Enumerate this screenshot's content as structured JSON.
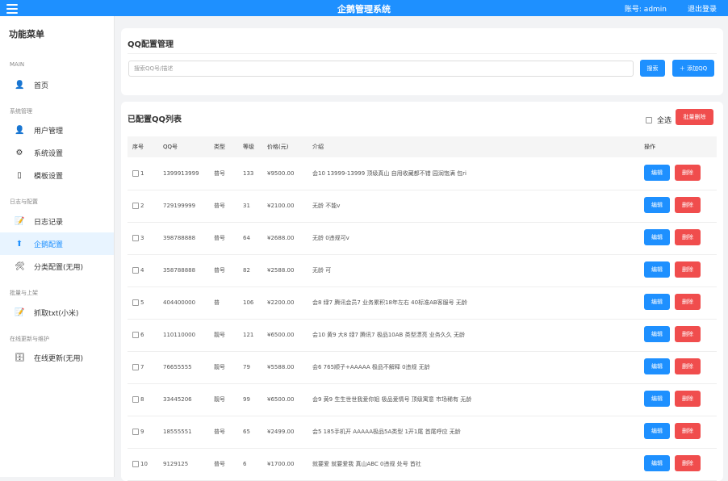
{
  "header": {
    "title": "企鹅管理系统",
    "account": "账号: admin",
    "logout": "退出登录"
  },
  "sidebar": {
    "title": "功能菜单",
    "sections": [
      {
        "label": "MAIN",
        "items": [
          {
            "label": "首页",
            "icon": "user-icon"
          }
        ]
      },
      {
        "label": "系统管理",
        "items": [
          {
            "label": "用户管理",
            "icon": "user-icon"
          },
          {
            "label": "系统设置",
            "icon": "gear-icon"
          },
          {
            "label": "模板设置",
            "icon": "template-icon"
          }
        ]
      },
      {
        "label": "日志与配置",
        "items": [
          {
            "label": "日志记录",
            "icon": "notepad-icon"
          },
          {
            "label": "企鹅配置",
            "icon": "arrow-up-icon"
          },
          {
            "label": "分类配置(无用)",
            "icon": "tools-icon"
          }
        ]
      },
      {
        "label": "批量与上架",
        "items": [
          {
            "label": "抓取txt(小米)",
            "icon": "notepad-icon"
          }
        ]
      },
      {
        "label": "在线更新与维护",
        "items": [
          {
            "label": "在线更新(无用)",
            "icon": "file-icon"
          }
        ]
      }
    ],
    "active": "企鹅配置"
  },
  "search_card": {
    "title": "QQ配置管理",
    "search_placeholder": "搜索QQ号/描述",
    "search_button": "搜索",
    "add_button": "＋ 添加QQ"
  },
  "list_card": {
    "title": "已配置QQ列表",
    "select_all": "全选",
    "batch_delete": "批量删除",
    "columns": [
      "序号",
      "QQ号",
      "类型",
      "等级",
      "价格(元)",
      "介绍",
      "操作"
    ],
    "edit_label": "编辑",
    "delete_label": "删除",
    "rows": [
      {
        "no": "1",
        "qq": "1399913999",
        "type": "普号",
        "level": "133",
        "price": "¥9500.00",
        "desc": "会10 13999-13999 顶级真山 自用收藏都不错 园润饱满 包ri"
      },
      {
        "no": "2",
        "qq": "729199999",
        "type": "普号",
        "level": "31",
        "price": "¥2100.00",
        "desc": "无龄 不能v"
      },
      {
        "no": "3",
        "qq": "398788888",
        "type": "普号",
        "level": "64",
        "price": "¥2688.00",
        "desc": "无龄 0违规可v"
      },
      {
        "no": "4",
        "qq": "358788888",
        "type": "普号",
        "level": "82",
        "price": "¥2588.00",
        "desc": "无龄 可"
      },
      {
        "no": "5",
        "qq": "404400000",
        "type": "普",
        "level": "106",
        "price": "¥2200.00",
        "desc": "会8 绿7 腾讯会员7 业务累积18年左右 40标准AB客服号 无龄"
      },
      {
        "no": "6",
        "qq": "110110000",
        "type": "靓号",
        "level": "121",
        "price": "¥6500.00",
        "desc": "会10 黄9 大8 绿7 腾讯7 极品10AB 类型漂亮 业务久久 无龄"
      },
      {
        "no": "7",
        "qq": "76655555",
        "type": "靓号",
        "level": "79",
        "price": "¥5588.00",
        "desc": "会6 765顺子+AAAAA 极品不解释 0违规 无龄"
      },
      {
        "no": "8",
        "qq": "33445206",
        "type": "靓号",
        "level": "99",
        "price": "¥6500.00",
        "desc": "会9 黄9 生生世世我爱你姐 极品爱情号 顶级寓意 市场稀有 无龄"
      },
      {
        "no": "9",
        "qq": "18555551",
        "type": "普号",
        "level": "65",
        "price": "¥2499.00",
        "desc": "会5 185手机开 AAAAA极品5A类型 1开1尾 首尾呼应 无龄"
      },
      {
        "no": "10",
        "qq": "9129125",
        "type": "普号",
        "level": "6",
        "price": "¥1700.00",
        "desc": "就要爱 就要爱我 真山ABC 0违规 处号 首社"
      }
    ]
  },
  "colors": {
    "primary": "#1e90ff",
    "danger": "#f04d4d"
  }
}
